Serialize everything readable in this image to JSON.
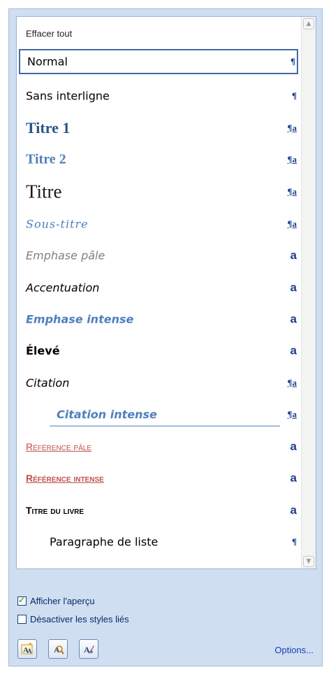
{
  "styles_list": {
    "clear_all": "Effacer tout",
    "items": [
      {
        "label": "Normal",
        "symbol": "¶",
        "kind": "para"
      },
      {
        "label": "Sans interligne",
        "symbol": "¶",
        "kind": "para"
      },
      {
        "label": "Titre 1",
        "symbol": "¶a",
        "kind": "link"
      },
      {
        "label": "Titre 2",
        "symbol": "¶a",
        "kind": "link"
      },
      {
        "label": "Titre",
        "symbol": "¶a",
        "kind": "link"
      },
      {
        "label": "Sous-titre",
        "symbol": "¶a",
        "kind": "link"
      },
      {
        "label": "Emphase pâle",
        "symbol": "a",
        "kind": "char"
      },
      {
        "label": "Accentuation",
        "symbol": "a",
        "kind": "char"
      },
      {
        "label": "Emphase intense",
        "symbol": "a",
        "kind": "char"
      },
      {
        "label": "Élevé",
        "symbol": "a",
        "kind": "char"
      },
      {
        "label": "Citation",
        "symbol": "¶a",
        "kind": "link"
      },
      {
        "label": "Citation intense",
        "symbol": "¶a",
        "kind": "link"
      },
      {
        "label": "Référence pâle",
        "symbol": "a",
        "kind": "char"
      },
      {
        "label": "Référence intense",
        "symbol": "a",
        "kind": "char"
      },
      {
        "label": "Titre du livre",
        "symbol": "a",
        "kind": "char"
      },
      {
        "label": "Paragraphe de liste",
        "symbol": "¶",
        "kind": "para"
      }
    ],
    "selected": "Normal"
  },
  "options": {
    "show_preview": {
      "label": "Afficher l'aperçu",
      "checked": true
    },
    "disable_linked": {
      "label": "Désactiver les styles liés",
      "checked": false
    }
  },
  "toolbar": {
    "new_style_icon": "new-style-icon",
    "style_inspector_icon": "style-inspector-icon",
    "manage_styles_icon": "manage-styles-icon",
    "options_label": "Options..."
  },
  "colors": {
    "pane_bg": "#cfdef1",
    "accent_blue": "#4f80bd",
    "heading_blue": "#2a5487",
    "reference_red": "#c0504d",
    "selection_border": "#3d6aa8"
  }
}
